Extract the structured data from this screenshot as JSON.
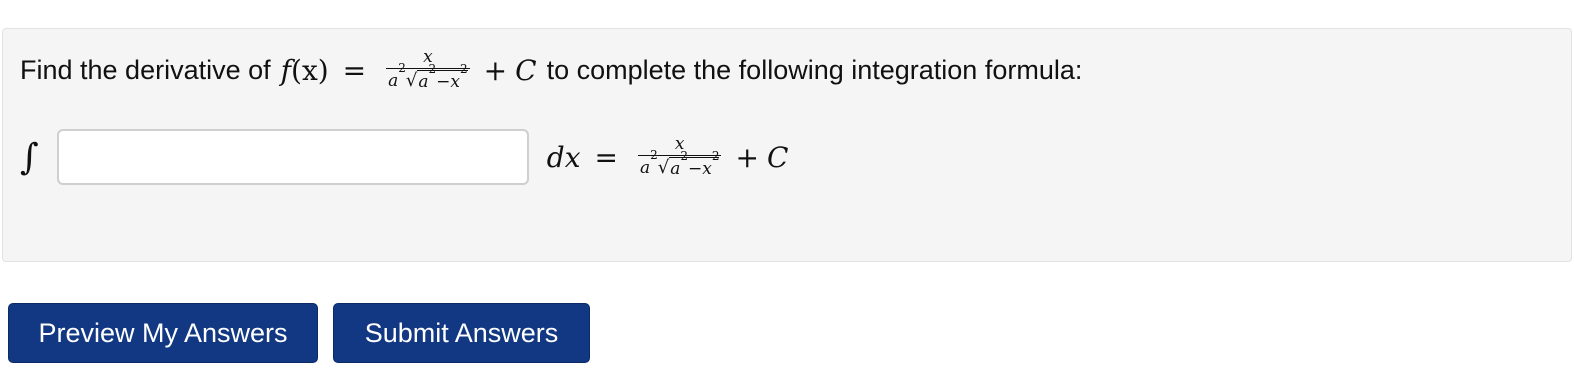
{
  "problem": {
    "intro": "Find the derivative of",
    "func_name": "f",
    "func_var": "(x)",
    "equals": "=",
    "frac_num": "x",
    "frac_den_a": "a",
    "frac_den_exp": "2",
    "sqrt_symbol": "√",
    "radicand_a": "a",
    "radicand_a_exp": "2",
    "radicand_minus": "−",
    "radicand_x": "x",
    "radicand_x_exp": "2",
    "plus": "+",
    "constant": "C",
    "outro": "to complete the following integration formula:"
  },
  "formula": {
    "integral_sign": "∫",
    "answer_value": "",
    "dx": "dx",
    "equals": "=",
    "frac_num": "x",
    "frac_den_a": "a",
    "frac_den_exp": "2",
    "sqrt_symbol": "√",
    "radicand_a": "a",
    "radicand_a_exp": "2",
    "radicand_minus": "−",
    "radicand_x": "x",
    "radicand_x_exp": "2",
    "plus": "+",
    "constant": "C"
  },
  "buttons": {
    "preview_label": "Preview My Answers",
    "submit_label": "Submit Answers",
    "color": "#123883"
  }
}
